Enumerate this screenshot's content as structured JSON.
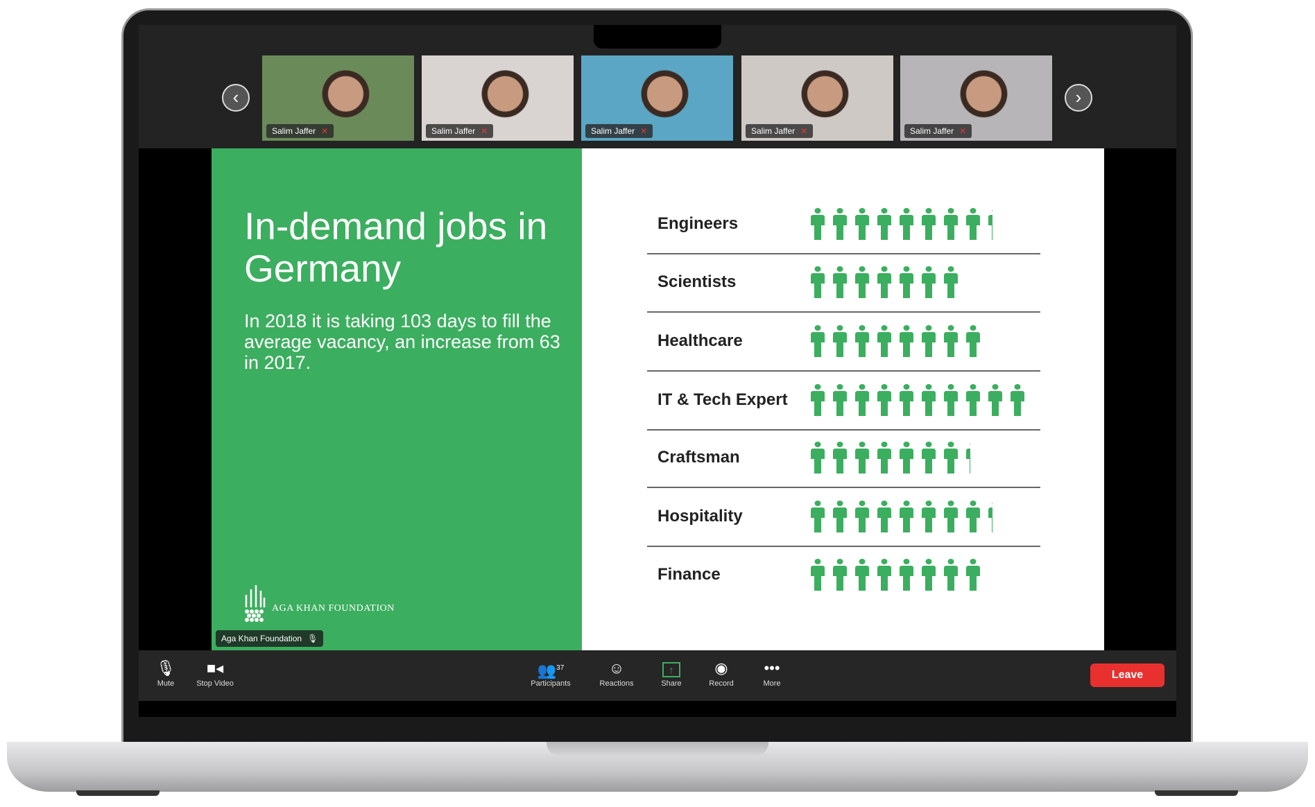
{
  "participants_strip": {
    "tiles": [
      {
        "name": "Salim Jaffer",
        "muted": true,
        "bg": "#6b8a5a"
      },
      {
        "name": "Salim Jaffer",
        "muted": true,
        "bg": "#d9d4d2"
      },
      {
        "name": "Salim Jaffer",
        "muted": true,
        "bg": "#5aa6c4"
      },
      {
        "name": "Salim Jaffer",
        "muted": true,
        "bg": "#cfc9c6"
      },
      {
        "name": "Salim Jaffer",
        "muted": true,
        "bg": "#b7b5b8"
      }
    ],
    "prev_icon": "chevron-left-icon",
    "next_icon": "chevron-right-icon"
  },
  "slide": {
    "title": "In-demand jobs in Germany",
    "body": "In 2018 it is taking 103 days to fill the average vacancy, an increase from 63 in 2017.",
    "logo_text": "AGA KHAN FOUNDATION",
    "accent": "#3cae5f",
    "chart_data": {
      "type": "bar",
      "categories": [
        "Engineers",
        "Scientists",
        "Healthcare",
        "IT & Tech Expert",
        "Craftsman",
        "Hospitality",
        "Finance"
      ],
      "values": [
        8.3,
        7,
        8,
        10,
        7.3,
        8.3,
        8
      ]
    }
  },
  "active_speaker": "Aga Khan Foundation",
  "toolbar": {
    "mute": "Mute",
    "stop_video": "Stop Video",
    "participants": "Participants",
    "participants_count": "37",
    "reactions": "Reactions",
    "share": "Share",
    "record": "Record",
    "more": "More",
    "leave": "Leave"
  }
}
